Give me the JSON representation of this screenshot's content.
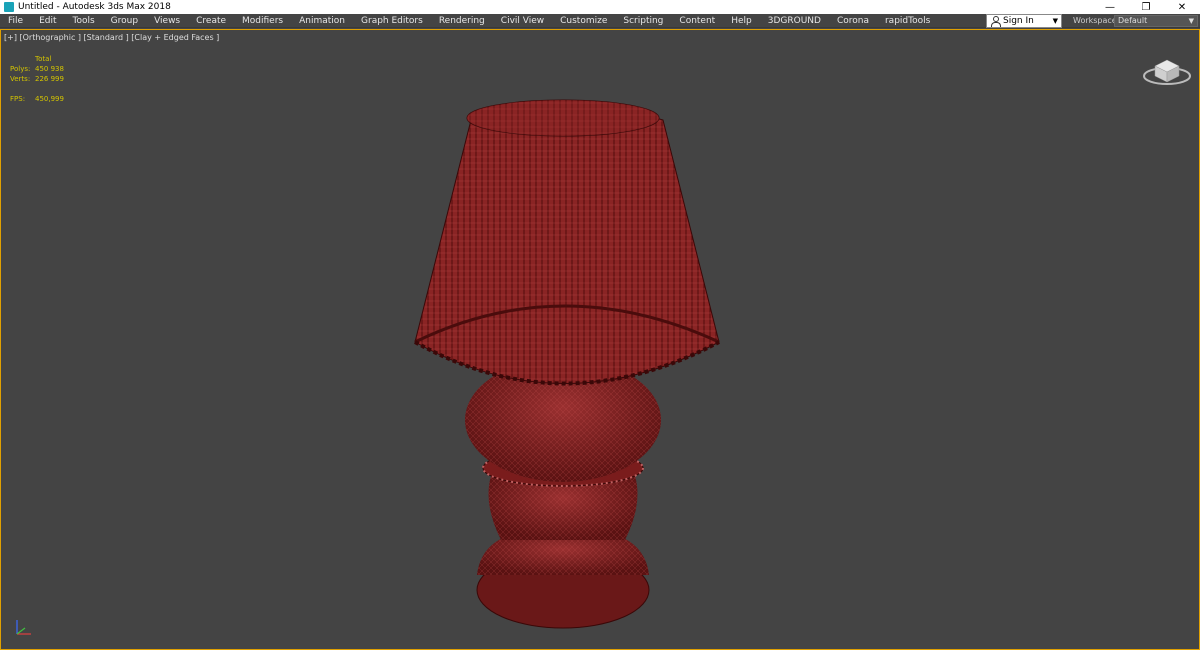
{
  "window": {
    "title": "Untitled - Autodesk 3ds Max 2018",
    "minimize": "—",
    "restore": "❐",
    "close": "✕"
  },
  "menu": [
    "File",
    "Edit",
    "Tools",
    "Group",
    "Views",
    "Create",
    "Modifiers",
    "Animation",
    "Graph Editors",
    "Rendering",
    "Civil View",
    "Customize",
    "Scripting",
    "Content",
    "Help",
    "3DGROUND",
    "Corona",
    "rapidTools"
  ],
  "account": {
    "signin_label": "Sign In",
    "dropdown": "▼"
  },
  "workspace": {
    "label": "Workspaces:",
    "value": "Default",
    "dropdown": "▼"
  },
  "viewport": {
    "label": "[+] [Orthographic ] [Standard ] [Clay + Edged Faces ]",
    "stats": {
      "header": "Total",
      "polys_label": "Polys:",
      "polys_value": "450 938",
      "verts_label": "Verts:",
      "verts_value": "226 999",
      "fps_label": "FPS:",
      "fps_value": "450,999"
    }
  },
  "icons": {
    "app": "3ds-max-icon",
    "viewcube": "viewcube-icon",
    "axis": "axis-tripod-icon",
    "user": "user-icon"
  },
  "colors": {
    "selection_border": "#e0a000",
    "stats_text": "#d4c400",
    "model_clay": "#7a1e1e",
    "wire": "#d05050"
  }
}
